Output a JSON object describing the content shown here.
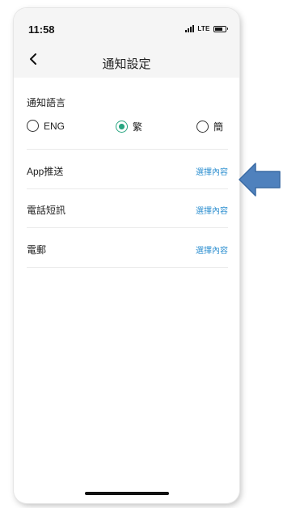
{
  "status_bar": {
    "time": "11:58",
    "network": "LTE"
  },
  "nav": {
    "title": "通知設定",
    "back_icon": "chevron-left-icon"
  },
  "language": {
    "label": "通知語言",
    "options": [
      {
        "label": "ENG",
        "selected": false
      },
      {
        "label": "繁",
        "selected": true
      },
      {
        "label": "簡",
        "selected": false
      }
    ]
  },
  "rows": [
    {
      "title": "App推送",
      "action": "選擇內容"
    },
    {
      "title": "電話短訊",
      "action": "選擇內容"
    },
    {
      "title": "電郵",
      "action": "選擇內容"
    }
  ],
  "colors": {
    "accent_green": "#27a580",
    "link_blue": "#2d8fd0",
    "annotation_arrow": "#4f81bd"
  }
}
